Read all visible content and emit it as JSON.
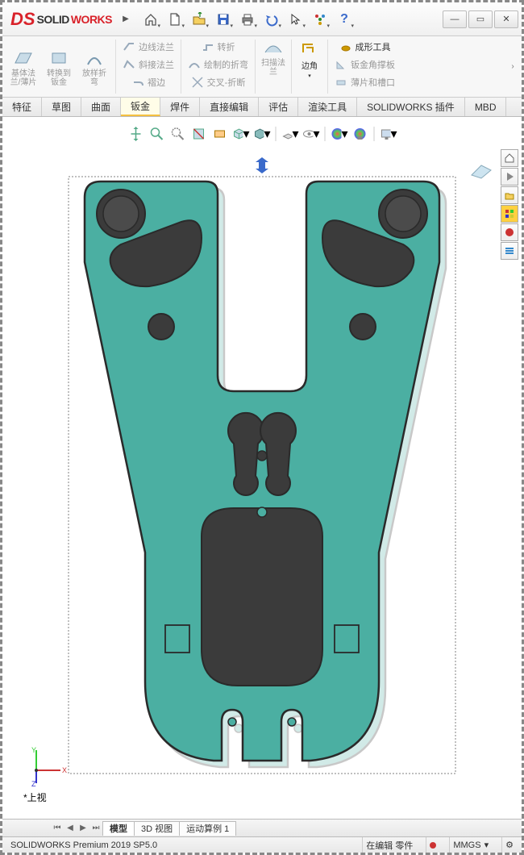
{
  "app": {
    "name1": "SOLID",
    "name2": "WORKS"
  },
  "toolbar": {
    "home": "home-icon",
    "new": "new-icon",
    "open": "open-icon",
    "save": "save-icon",
    "print": "print-icon",
    "undo": "undo-icon",
    "select": "select-icon",
    "rebuild": "rebuild-icon",
    "help": "help-icon"
  },
  "ribbon": {
    "g1": [
      "基体法\n兰/薄片",
      "转换到\n钣金",
      "放样折\n弯"
    ],
    "g2": [
      "边线法兰",
      "斜接法兰",
      "褶边"
    ],
    "g3": [
      "转折",
      "绘制的折弯",
      "交叉-折断"
    ],
    "g4": "扫描法\n兰",
    "corners": {
      "main": "边角",
      "sub1": "成形工具",
      "sub2": "钣金角撑板",
      "sub3": "薄片和槽口"
    }
  },
  "tabs": [
    "特征",
    "草图",
    "曲面",
    "钣金",
    "焊件",
    "直接编辑",
    "评估",
    "渲染工具",
    "SOLIDWORKS 插件",
    "MBD"
  ],
  "activeTab": 3,
  "viewLabel": "*上视",
  "bottomTabs": [
    "模型",
    "3D 视图",
    "运动算例 1"
  ],
  "activeBottomTab": 0,
  "status": {
    "version": "SOLIDWORKS Premium 2019 SP5.0",
    "mode": "在编辑 零件",
    "units": "MMGS"
  },
  "part": {
    "color": "#4bafa2",
    "stroke": "#2a2a2a"
  }
}
